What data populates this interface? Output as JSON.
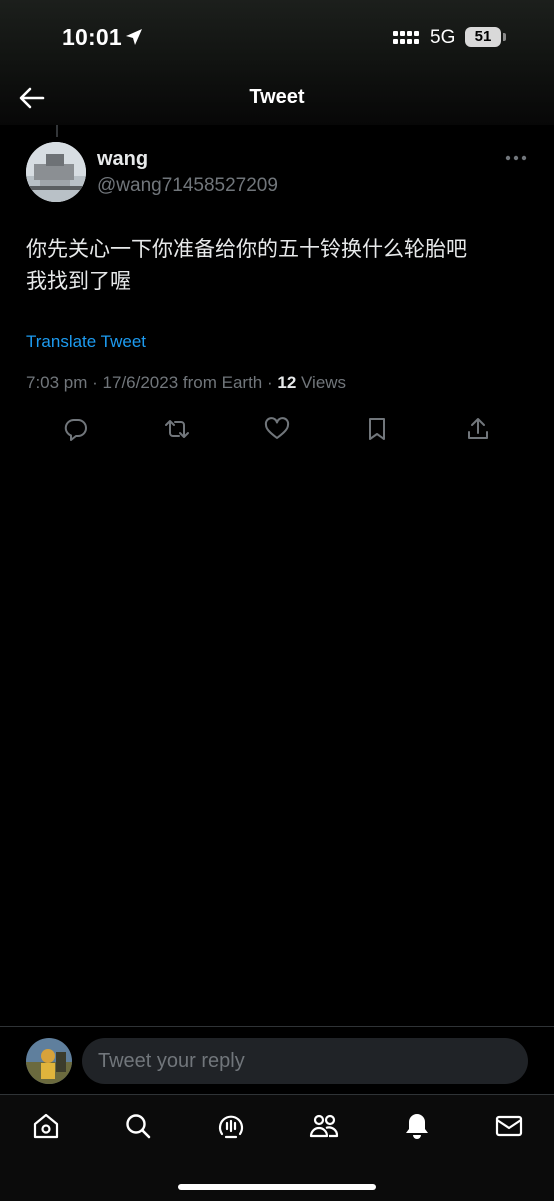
{
  "status_bar": {
    "time": "10:01",
    "network": "5G",
    "battery": "51",
    "location_icon": "location-arrow-icon",
    "signal_icon": "signal-bars-icon"
  },
  "header": {
    "title": "Tweet",
    "back_icon": "back-arrow-icon"
  },
  "tweet": {
    "author": {
      "name": "wang",
      "handle": "@wang71458527209"
    },
    "text_lines": [
      "你先关心一下你准备给你的五十铃换什么轮胎吧",
      "我找到了喔"
    ],
    "translate_label": "Translate Tweet",
    "timestamp": "7:03 pm · 17/6/2023 from Earth · ",
    "views_count": "12",
    "views_label": " Views",
    "actions": [
      "reply-icon",
      "retweet-icon",
      "like-icon",
      "bookmark-icon",
      "share-icon"
    ]
  },
  "reply_bar": {
    "placeholder": "Tweet your reply"
  },
  "bottom_nav": {
    "items": [
      "home-icon",
      "search-icon",
      "spaces-icon",
      "communities-icon",
      "notifications-icon",
      "messages-icon"
    ]
  },
  "colors": {
    "background": "#000000",
    "text": "#e7e9ea",
    "secondary_text": "#71767b",
    "link": "#1d9bf0",
    "input_background": "#202327"
  }
}
